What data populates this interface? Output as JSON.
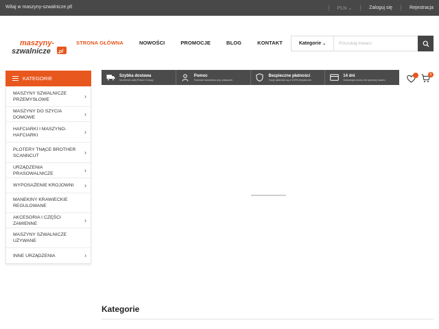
{
  "topbar": {
    "welcome": "Witaj w maszyny-szwalnicze.pl!",
    "currency": "PLN",
    "login": "Zaloguj się",
    "register": "Rejestracja"
  },
  "logo": {
    "line1": "maszyny-",
    "line2": "szwalnicze",
    "suffix": ".pl"
  },
  "nav": [
    {
      "label": "STRONA GŁÓWNA"
    },
    {
      "label": "NOWOŚCI"
    },
    {
      "label": "PROMOCJE"
    },
    {
      "label": "BLOG"
    },
    {
      "label": "KONTAKT"
    }
  ],
  "search": {
    "category_label": "Kategorie",
    "placeholder": "Poszukaj towaru"
  },
  "sidebar": {
    "title": "KATEGORIE",
    "items": [
      {
        "label": "MASZYNY SZWALNICZE PRZEMYSŁOWE",
        "has_arrow": true
      },
      {
        "label": "MASZYNY DO SZYCIA DOMOWE",
        "has_arrow": true
      },
      {
        "label": "HAFCIARKI I MASZYNO-HAFCIARKI",
        "has_arrow": true
      },
      {
        "label": "PLOTERY TNĄCE BROTHER SCANNCUT",
        "has_arrow": true
      },
      {
        "label": "URZĄDZENIA PRASOWALNICZE",
        "has_arrow": true
      },
      {
        "label": "WYPOSAŻENIE KROJOWNI",
        "has_arrow": true
      },
      {
        "label": "MANEKINY KRAWIECKIE REGULOWANE",
        "has_arrow": false
      },
      {
        "label": "AKCESORIA I CZĘŚCI ZAMIENNE",
        "has_arrow": true
      },
      {
        "label": "MASZYNY SZWALNICZE UŻYWANE",
        "has_arrow": false
      },
      {
        "label": "INNE URZĄDZENIA",
        "has_arrow": true
      }
    ]
  },
  "features": [
    {
      "title": "Szybka dostawa",
      "subtitle": "Na terenie całej Polski i Europy",
      "icon": "truck-icon"
    },
    {
      "title": "Pomoc",
      "subtitle": "Fachowe doradztwo przy zakupach",
      "icon": "user-icon"
    },
    {
      "title": "Bezpieczne płatności",
      "subtitle": "Twoje płatności są w 100% bezpieczne",
      "icon": "shield-icon"
    },
    {
      "title": "14 dni",
      "subtitle": "Gwarancja zwrotu lub wymiany towaru",
      "icon": "card-icon"
    }
  ],
  "wishlist_count": "",
  "cart_count": "0",
  "main": {
    "section_title": "Kategorie"
  },
  "colors": {
    "accent": "#e8571e",
    "topbar": "#484848",
    "features_bg": "#4b4b4b"
  }
}
